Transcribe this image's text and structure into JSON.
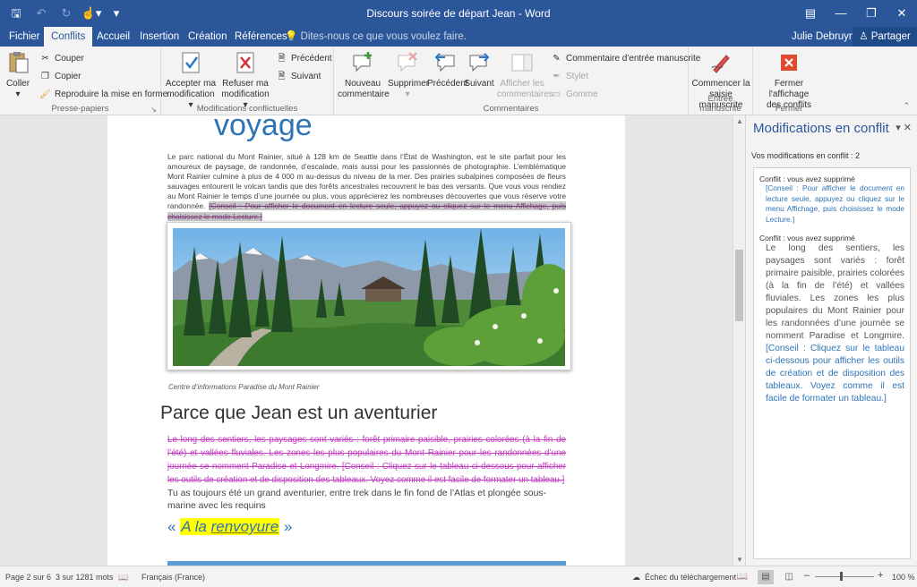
{
  "window": {
    "title": "Discours soirée de départ Jean - Word",
    "qat_icons": [
      "save-icon",
      "undo-icon",
      "redo-icon",
      "touch-mode-icon",
      "customize-qat-icon"
    ],
    "controls": [
      "ribbon-display-icon",
      "minimize-icon",
      "restore-icon",
      "close-icon"
    ]
  },
  "tabs": [
    "Fichier",
    "Conflits",
    "Accueil",
    "Insertion",
    "Création",
    "Références"
  ],
  "active_tab": "Conflits",
  "tell_me": "Dites-nous ce que vous voulez faire.",
  "user_name": "Julie Debruyne",
  "share_label": "Partager",
  "ribbon": {
    "clipboard": {
      "title": "Presse-papiers",
      "paste": "Coller",
      "cut": "Couper",
      "copy": "Copier",
      "format_painter": "Reproduire la mise en forme"
    },
    "conflicts": {
      "title": "Modifications conflictuelles",
      "accept_l1": "Accepter ma",
      "accept_l2": "modification",
      "reject_l1": "Refuser ma",
      "reject_l2": "modification",
      "previous": "Précédent",
      "next": "Suivant"
    },
    "comments": {
      "title": "Commentaires",
      "new_l1": "Nouveau",
      "new_l2": "commentaire",
      "delete": "Supprimer",
      "previous": "Précédent",
      "next": "Suivant",
      "show_l1": "Afficher les",
      "show_l2": "commentaires",
      "ink_comment": "Commentaire d'entrée manuscrite",
      "pen": "Stylet",
      "eraser": "Gomme"
    },
    "ink": {
      "title": "Entrée manuscrite",
      "start_l1": "Commencer la",
      "start_l2": "saisie manuscrite"
    },
    "close": {
      "title": "Fermer",
      "close_l1": "Fermer l'affichage",
      "close_l2": "des conflits"
    }
  },
  "document": {
    "heading": "voyage",
    "para1": "Le parc national du Mont Rainier, situé à 128 km de Seattle dans l’État de Washington, est le site parfait pour les amoureux de paysage, de randonnée, d’escalade, mais aussi pour les passionnés de photographie. L’emblématique Mont Rainier culmine à plus de 4 000 m au-dessus du niveau de la mer. Des prairies subalpines composées de fleurs sauvages entourent le volcan tandis que des forêts ancestrales recouvrent le bas des versants. Que vous vous rendiez au Mont Rainier le temps d’une journée ou plus, vous apprécierez les nombreuses découvertes que vous réserve votre randonnée. ",
    "para1_conflict": "[Conseil : Pour afficher le document en lecture seule, appuyez ou cliquez sur le menu Affichage, puis choisissez le mode Lecture.]",
    "caption": "Centre d’informations Paradise du Mont Rainier",
    "heading2": "Parce que Jean est un aventurier",
    "para2_deleted": "Le long des sentiers, les paysages sont variés : forêt primaire paisible, prairies colorées (à la fin de l’été) et vallées fluviales. Les zones les plus populaires du Mont Rainier pour les randonnées d’une journée se nomment Paradise et Longmire. [Conseil : Cliquez sur le tableau ci-dessous pour afficher les outils de création et de disposition des tableaux. Voyez comme il est facile de formater un tableau.]",
    "para3": "Tu as toujours été un grand aventurier, entre trek dans le fin fond de l’Atlas et plongée sous-marine avec les requins",
    "quote_open": "« ",
    "quote_a": "A la ",
    "quote_b": "renvoyure",
    "quote_close": " »"
  },
  "pane": {
    "title": "Modifications en conflit",
    "count": "Vos modifications en conflit : 2",
    "conflicts": [
      {
        "head": "Conflit : vous avez supprimé",
        "text": "[Conseil : Pour afficher le document en lecture seule, appuyez ou cliquez sur le menu Affichage, puis choisissez le mode Lecture.]"
      },
      {
        "head": "Conflit : vous avez supprimé",
        "text": "Le long des sentiers, les paysages sont variés : forêt primaire paisible, prairies colorées (à la fin de l’été) et vallées fluviales. Les zones les plus populaires du Mont Rainier pour les randonnées d’une journée se nomment Paradise et Longmire. ",
        "tip": "[Conseil : Cliquez sur le tableau ci-dessous pour afficher les outils de création et de disposition des tableaux. Voyez comme il est facile de formater un tableau.]"
      }
    ]
  },
  "status": {
    "page": "Page 2 sur 6",
    "words": "3 sur 1281 mots",
    "language": "Français (France)",
    "upload": "Échec du téléchargement",
    "zoom": "100 %"
  },
  "colors": {
    "brand": "#2b579a",
    "heading_blue": "#2e74b5",
    "deleted_magenta": "#c03cc0",
    "highlight": "#ffff00"
  }
}
